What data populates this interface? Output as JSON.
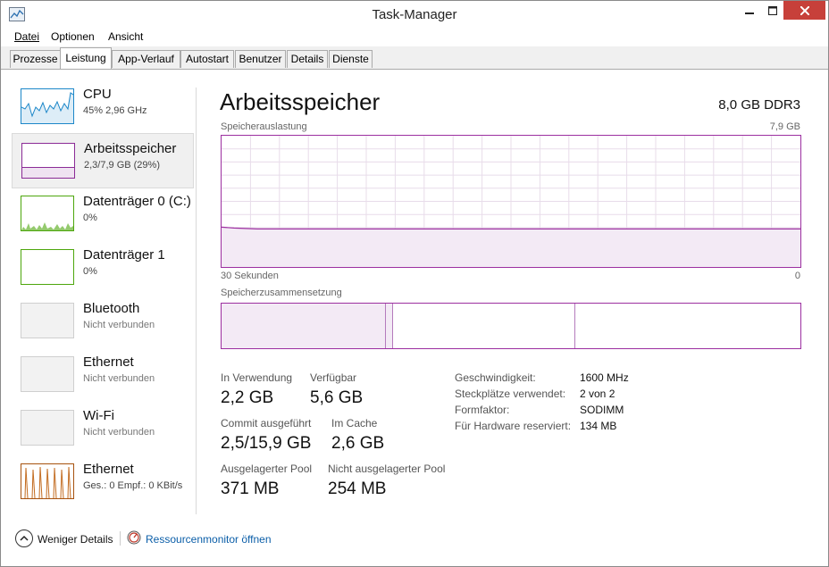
{
  "window": {
    "title": "Task-Manager"
  },
  "menu": {
    "datei": "Datei",
    "optionen": "Optionen",
    "ansicht": "Ansicht"
  },
  "tabs": [
    {
      "label": "Prozesse"
    },
    {
      "label": "Leistung"
    },
    {
      "label": "App-Verlauf"
    },
    {
      "label": "Autostart"
    },
    {
      "label": "Benutzer"
    },
    {
      "label": "Details"
    },
    {
      "label": "Dienste"
    }
  ],
  "sidebar": {
    "items": [
      {
        "name": "CPU",
        "sub": "45%  2,96 GHz",
        "color": "#1c87c9"
      },
      {
        "name": "Arbeitsspeicher",
        "sub": "2,3/7,9 GB (29%)",
        "color": "#8b2b96"
      },
      {
        "name": "Datenträger 0 (C:)",
        "sub": "0%",
        "color": "#4da60c"
      },
      {
        "name": "Datenträger 1",
        "sub": "0%",
        "color": "#4da60c"
      },
      {
        "name": "Bluetooth",
        "sub": "Nicht verbunden"
      },
      {
        "name": "Ethernet",
        "sub": "Nicht verbunden"
      },
      {
        "name": "Wi-Fi",
        "sub": "Nicht verbunden"
      },
      {
        "name": "Ethernet",
        "sub": "Ges.: 0  Empf.: 0 KBit/s",
        "color": "#a7520e"
      }
    ]
  },
  "main": {
    "title": "Arbeitsspeicher",
    "spec": "8,0 GB DDR3",
    "usage_label": "Speicherauslastung",
    "usage_max": "7,9 GB",
    "time_left": "30 Sekunden",
    "time_right": "0",
    "composition_label": "Speicherzusammensetzung",
    "accent": "#9c2fa0",
    "usage_fraction": 0.29
  },
  "stats": {
    "in_use_label": "In Verwendung",
    "in_use": "2,2 GB",
    "available_label": "Verfügbar",
    "available": "5,6 GB",
    "commit_label": "Commit ausgeführt",
    "commit": "2,5/15,9 GB",
    "cache_label": "Im Cache",
    "cache": "2,6 GB",
    "paged_label": "Ausgelagerter Pool",
    "paged": "371 MB",
    "nonpaged_label": "Nicht ausgelagerter Pool",
    "nonpaged": "254 MB"
  },
  "specs": [
    {
      "label": "Geschwindigkeit:",
      "value": "1600 MHz"
    },
    {
      "label": "Steckplätze verwendet:",
      "value": "2 von 2"
    },
    {
      "label": "Formfaktor:",
      "value": "SODIMM"
    },
    {
      "label": "Für Hardware reserviert:",
      "value": "134 MB"
    }
  ],
  "footer": {
    "less_details": "Weniger Details",
    "resource_monitor": "Ressourcenmonitor öffnen"
  }
}
